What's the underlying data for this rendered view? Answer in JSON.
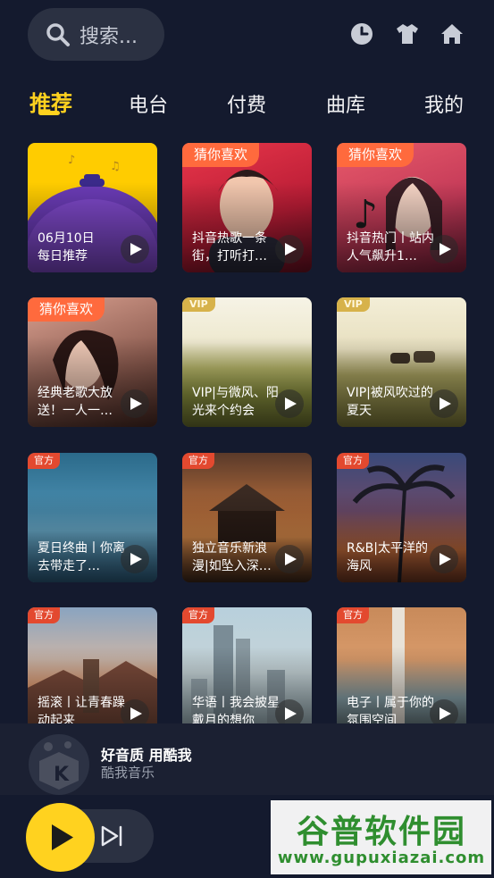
{
  "search": {
    "placeholder": "搜索..."
  },
  "top_icons": [
    "history-icon",
    "skin-shirt-icon",
    "home-icon"
  ],
  "tabs": [
    {
      "label": "推荐",
      "active": true
    },
    {
      "label": "电台",
      "active": false
    },
    {
      "label": "付费",
      "active": false
    },
    {
      "label": "曲库",
      "active": false
    },
    {
      "label": "我的",
      "active": false
    }
  ],
  "cards": [
    {
      "title": "06月10日\n每日推荐",
      "badge": ""
    },
    {
      "title": "抖音热歌一条街，打听打…",
      "badge": "猜你喜欢"
    },
    {
      "title": "抖音热门丨站内人气飙升1…",
      "badge": "猜你喜欢"
    },
    {
      "title": "经典老歌大放送！一人一…",
      "badge": "猜你喜欢"
    },
    {
      "title": "VIP|与微风、阳光来个约会",
      "badge": "VIP"
    },
    {
      "title": "VIP|被风吹过的夏天",
      "badge": "VIP"
    },
    {
      "title": "夏日终曲丨你离去带走了…",
      "badge": "官方"
    },
    {
      "title": "独立音乐新浪漫|如坠入深…",
      "badge": "官方"
    },
    {
      "title": "R&B|太平洋的海风",
      "badge": "官方"
    },
    {
      "title": "摇滚丨让青春躁动起来",
      "badge": "官方"
    },
    {
      "title": "华语丨我会披星戴月的想你",
      "badge": "官方"
    },
    {
      "title": "电子丨属于你的氛围空间",
      "badge": "官方"
    }
  ],
  "mini_player": {
    "title": "好音质 用酷我",
    "subtitle": "酷我音乐"
  },
  "watermark": {
    "main": "谷普软件园",
    "url": "www.gupuxiazai.com"
  },
  "colors": {
    "accent": "#ffd21f",
    "background": "#141a2e",
    "badge_guess": "#ff6a3d",
    "badge_vip": "#d7b24a",
    "badge_official": "#e3492f"
  }
}
